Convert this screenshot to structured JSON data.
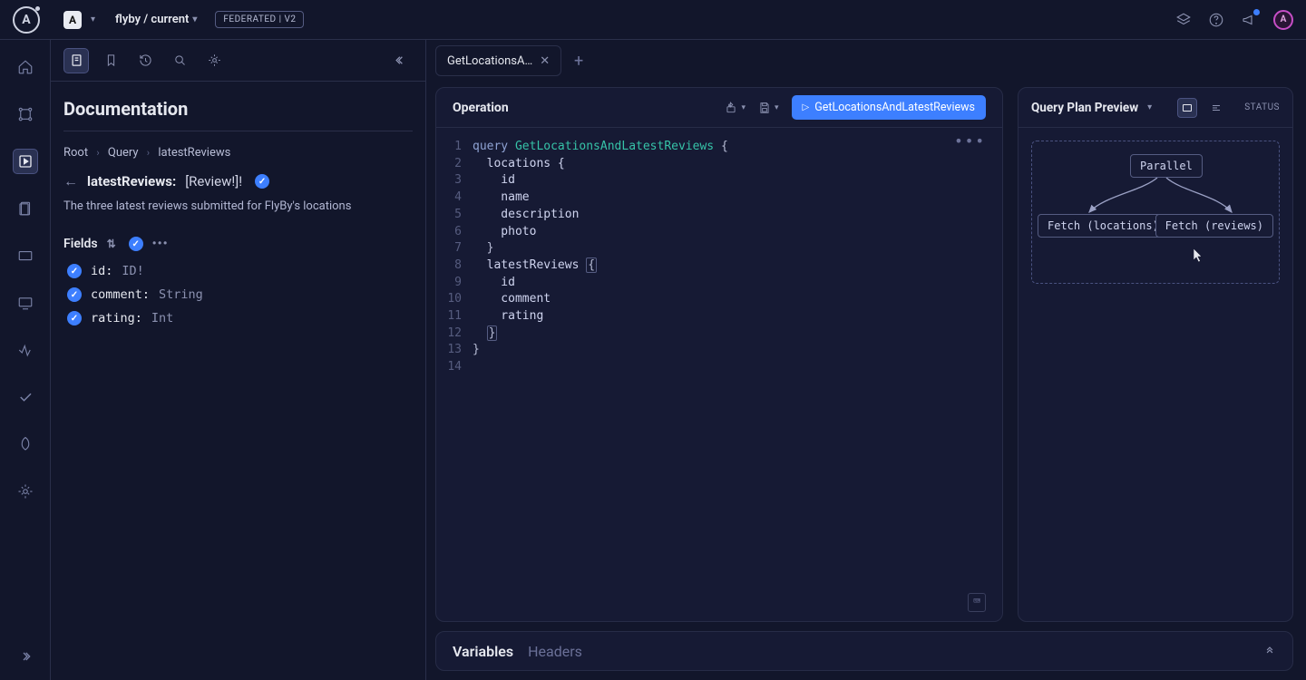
{
  "topbar": {
    "logo_letter": "A",
    "org_badge": "A",
    "graph_path": "flyby / current",
    "federated_badge": "FEDERATED | V2",
    "avatar_letter": "A"
  },
  "doc": {
    "title": "Documentation",
    "crumb_root": "Root",
    "crumb_query": "Query",
    "crumb_field": "latestReviews",
    "field_name": "latestReviews:",
    "field_type": "[Review!]!",
    "field_description": "The three latest reviews submitted for FlyBy's locations",
    "fields_heading": "Fields",
    "fields": [
      {
        "name": "id:",
        "type": "ID!"
      },
      {
        "name": "comment:",
        "type": "String"
      },
      {
        "name": "rating:",
        "type": "Int"
      }
    ]
  },
  "tabs": {
    "active_label": "GetLocationsA…"
  },
  "operation": {
    "panel_title": "Operation",
    "run_label": "GetLocationsAndLatestReviews",
    "code": {
      "l1_kw": "query",
      "l1_name": "GetLocationsAndLatestReviews",
      "l1_open": " {",
      "l2": "  locations {",
      "l3": "    id",
      "l4": "    name",
      "l5": "    description",
      "l6": "    photo",
      "l7": "  }",
      "l8a": "  latestReviews ",
      "l8b": "{",
      "l9": "    id",
      "l10": "    comment",
      "l11": "    rating",
      "l12": "  }",
      "l13": "}",
      "l14": ""
    },
    "line_numbers": [
      "1",
      "2",
      "3",
      "4",
      "5",
      "6",
      "7",
      "8",
      "9",
      "10",
      "11",
      "12",
      "13",
      "14"
    ]
  },
  "vars": {
    "variables_label": "Variables",
    "headers_label": "Headers"
  },
  "plan": {
    "title": "Query Plan Preview",
    "status_label": "STATUS",
    "root_node": "Parallel",
    "left_node": "Fetch (locations)",
    "right_node": "Fetch (reviews)"
  }
}
